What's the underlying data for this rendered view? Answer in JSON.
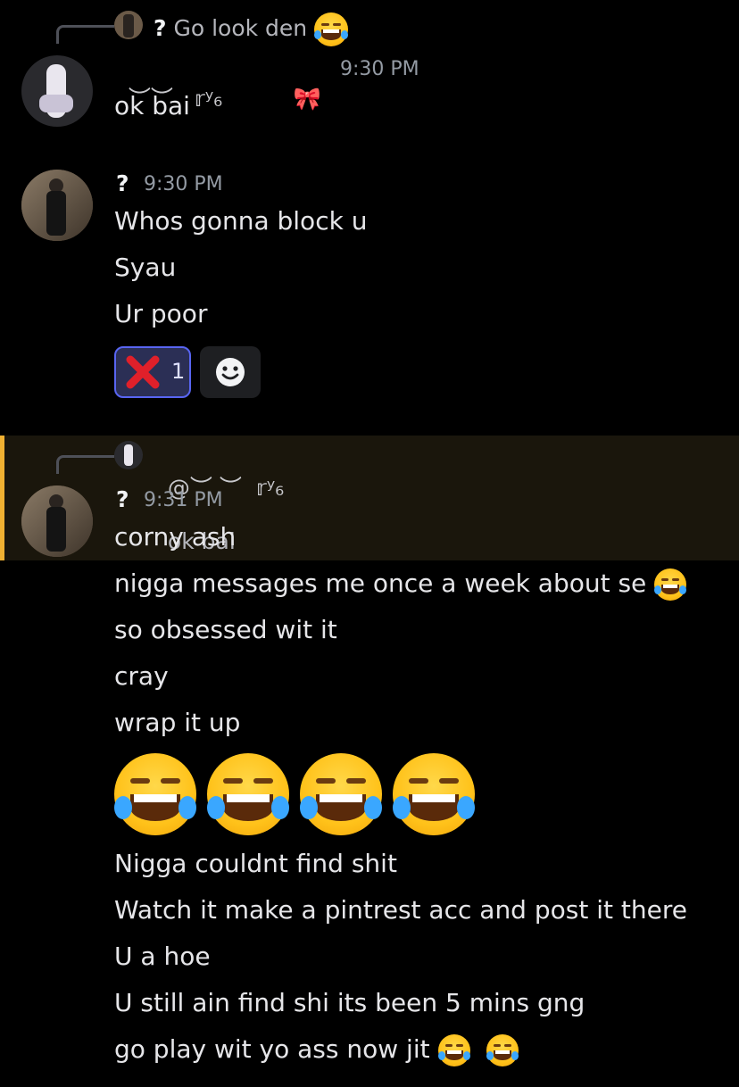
{
  "messages": [
    {
      "reply": {
        "author": "?",
        "text": "Go look den"
      },
      "author_deco": "︶︶   𝕣ʸ₆          🎀",
      "time": "9:30 PM",
      "lines": [
        "ok bai"
      ]
    },
    {
      "author": "?",
      "time": "9:30 PM",
      "lines": [
        "Whos gonna block u",
        "Syau",
        "Ur poor"
      ],
      "reaction": {
        "count": "1"
      }
    },
    {
      "reply": {
        "author": "@︶ ︶  𝕣ʸ₆",
        "text": "ok bai"
      },
      "author": "?",
      "time": "9:31 PM",
      "lines": [
        "corny ash",
        "nigga messages me once a week about se",
        "so obsessed wit it",
        "cray",
        "wrap it up",
        "",
        "Nigga couldnt find shit",
        "Watch it make a pintrest acc and post it there",
        "U a hoe",
        "U still ain find shi its been 5 mins gng",
        "go play wit yo ass now jit"
      ]
    }
  ],
  "colors": {
    "mention_highlight": "#f0b132",
    "reaction_border": "#5865f2",
    "timestamp": "#949ba4"
  },
  "icons": [
    "joy-emoji",
    "cross-mark-emoji",
    "add-reaction-icon",
    "bow-icon"
  ]
}
